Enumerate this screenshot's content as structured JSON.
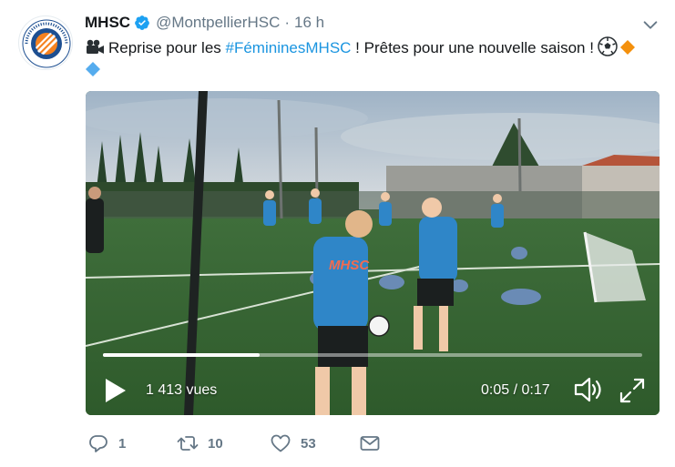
{
  "tweet": {
    "author_name": "MHSC",
    "handle": "@MontpellierHSC",
    "separator": "·",
    "time": "16 h",
    "text_before": "Reprise pour les ",
    "hashtag": "#FémininesMHSC",
    "text_after": " ! Prêtes pour une nouvelle saison !",
    "logo_text": "MONTPELLIER Hérault Sport Club 1974"
  },
  "video": {
    "views": "1 413 vues",
    "timecode": "0:05 / 0:17",
    "progress": 0.29,
    "shirt_text": "MHSC"
  },
  "actions": {
    "replies": "1",
    "retweets": "10",
    "likes": "53"
  },
  "colors": {
    "hashtag": "#1b95e0",
    "verified": "#1da1f2",
    "action_gray": "#657786",
    "club_orange": "#f58220",
    "club_blue": "#1d4f91"
  },
  "icons": {
    "verified": "verified-badge-icon",
    "chevron": "chevron-down-icon",
    "camera": "movie-camera-icon",
    "ball": "soccer-ball-icon",
    "reply": "reply-icon",
    "retweet": "retweet-icon",
    "like": "heart-icon",
    "dm": "envelope-icon",
    "play": "play-icon",
    "volume": "volume-icon",
    "fullscreen": "fullscreen-icon"
  }
}
